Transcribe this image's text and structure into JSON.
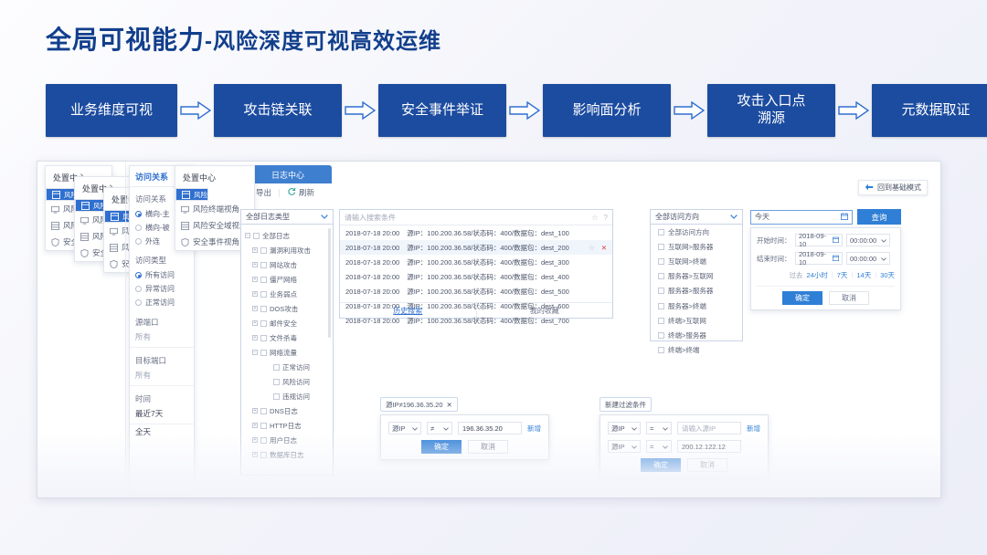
{
  "title": {
    "main": "全局可视能力",
    "sub": "-风险深度可视高效运维"
  },
  "flow": {
    "steps": [
      {
        "label": "业务维度可视"
      },
      {
        "label": "攻击链关联"
      },
      {
        "label": "安全事件举证"
      },
      {
        "label": "影响面分析"
      },
      {
        "label": "攻击入口点\n溯源"
      },
      {
        "label": "元数据取证"
      }
    ],
    "arrow_icon": "arrow-right-outline"
  },
  "app": {
    "cascade_panels": [
      {
        "title": "处置中心",
        "items": [
          "风险业务视角",
          "风险终端视角",
          "风险安全域视角",
          "安全事件视角"
        ]
      },
      {
        "title": "处置中心",
        "items": [
          "风险业务视角",
          "风险终端视角",
          "风险安全域视角",
          "安全事件视角"
        ]
      },
      {
        "title": "处置中心",
        "items": [
          "风险业务视角",
          "风险终端视角",
          "风险安全域视角",
          "安全事件视角"
        ]
      },
      {
        "title": "处置中心",
        "items": [
          "风险业务视角",
          "风险终端视角",
          "风险安全域视角",
          "安全事件视角"
        ]
      }
    ],
    "tab": {
      "label": "日志中心"
    },
    "toolbar": {
      "export": "导出",
      "refresh": "刷新",
      "export_icon": "export-icon",
      "refresh_icon": "refresh-icon"
    },
    "back_mode": {
      "label": "回到基础模式",
      "icon": "arrow-left-icon"
    },
    "relation_panel": {
      "tab_label": "访问关系",
      "group1_title": "访问关系",
      "group1_options": [
        "横向-主",
        "横向-被",
        "外连"
      ],
      "group1_selected": "横向-主",
      "group2_title": "访问类型",
      "group2_options": [
        "所有访问",
        "异常访问",
        "正常访问"
      ],
      "group2_selected": "所有访问",
      "src_port_label": "源端口",
      "src_port_value": "所有",
      "dst_port_label": "目标端口",
      "dst_port_value": "所有",
      "time_label": "时间",
      "time_value": "最近7天",
      "time_value2": "全天"
    },
    "log_tree": {
      "selected": "全部日志类型",
      "root": "全部日志",
      "nodes": [
        "漏洞利用攻击",
        "网站攻击",
        "僵尸网络",
        "业务弱点",
        "DOS攻击",
        "邮件安全",
        "文件杀毒",
        "网络流量"
      ],
      "children": [
        "正常访问",
        "风险访问",
        "违规访问"
      ],
      "nodes2": [
        "DNS日志",
        "HTTP日志",
        "用户日志",
        "数据库日志"
      ]
    },
    "search": {
      "placeholder": "请输入搜索条件",
      "star_icon": "star-icon",
      "help_icon": "help-icon",
      "rows": [
        {
          "time": "2018-07-18 20:00",
          "detail": "源IP：100.200.36.58/状态码：400/数据包：dest_100"
        },
        {
          "time": "2018-07-18 20:00",
          "detail": "源IP：100.200.36.58/状态码：400/数据包：dest_200"
        },
        {
          "time": "2018-07-18 20:00",
          "detail": "源IP：100.200.36.58/状态码：400/数据包：dest_300"
        },
        {
          "time": "2018-07-18 20:00",
          "detail": "源IP：100.200.36.58/状态码：400/数据包：dest_400"
        },
        {
          "time": "2018-07-18 20:00",
          "detail": "源IP：100.200.36.58/状态码：400/数据包：dest_500"
        },
        {
          "time": "2018-07-18 20:00",
          "detail": "源IP：100.200.36.58/状态码：400/数据包：dest_600"
        },
        {
          "time": "2018-07-18 20:00",
          "detail": "源IP：100.200.36.58/状态码：400/数据包：dest_700"
        }
      ],
      "highlighted_index": 1,
      "footer_tabs": [
        "历史搜索",
        "我的收藏"
      ]
    },
    "direction": {
      "selected": "全部访问方向",
      "options": [
        "全部访问方向",
        "互联网>服务器",
        "互联网>终端",
        "服务器>互联网",
        "服务器>服务器",
        "服务器>终端",
        "终端>互联网",
        "终端>服务器",
        "终端>终端"
      ]
    },
    "date_picker": {
      "field_value": "今天",
      "calendar_icon": "calendar-icon",
      "query_button": "查询",
      "start_label": "开始时间：",
      "start_date": "2018-09-10",
      "start_time": "00:00:00",
      "end_label": "结束时间：",
      "end_date": "2018-09-10",
      "end_time": "00:00:00",
      "quick_label": "过去",
      "quick_options": [
        "24小时",
        "7天",
        "14天",
        "30天"
      ],
      "confirm": "确定",
      "cancel": "取消"
    },
    "filter_popup_left": {
      "tag": "源IP≠196.36.35.20",
      "close_icon": "close-icon",
      "field": "源IP",
      "operator": "≠",
      "value": "196.36.35.20",
      "add_link": "新增",
      "confirm": "确定",
      "cancel": "取消"
    },
    "filter_popup_right": {
      "tag": "新建过滤条件",
      "row1_field": "源IP",
      "row1_operator": "=",
      "row1_placeholder": "请输入源IP",
      "add_link": "新增",
      "row2_field": "源IP",
      "row2_operator": "=",
      "row2_value": "200.12.122.12",
      "confirm": "确定",
      "cancel": "取消"
    }
  },
  "colors": {
    "brand": "#1c4ca0",
    "accent": "#2f7fd6",
    "title": "#123f8c"
  }
}
